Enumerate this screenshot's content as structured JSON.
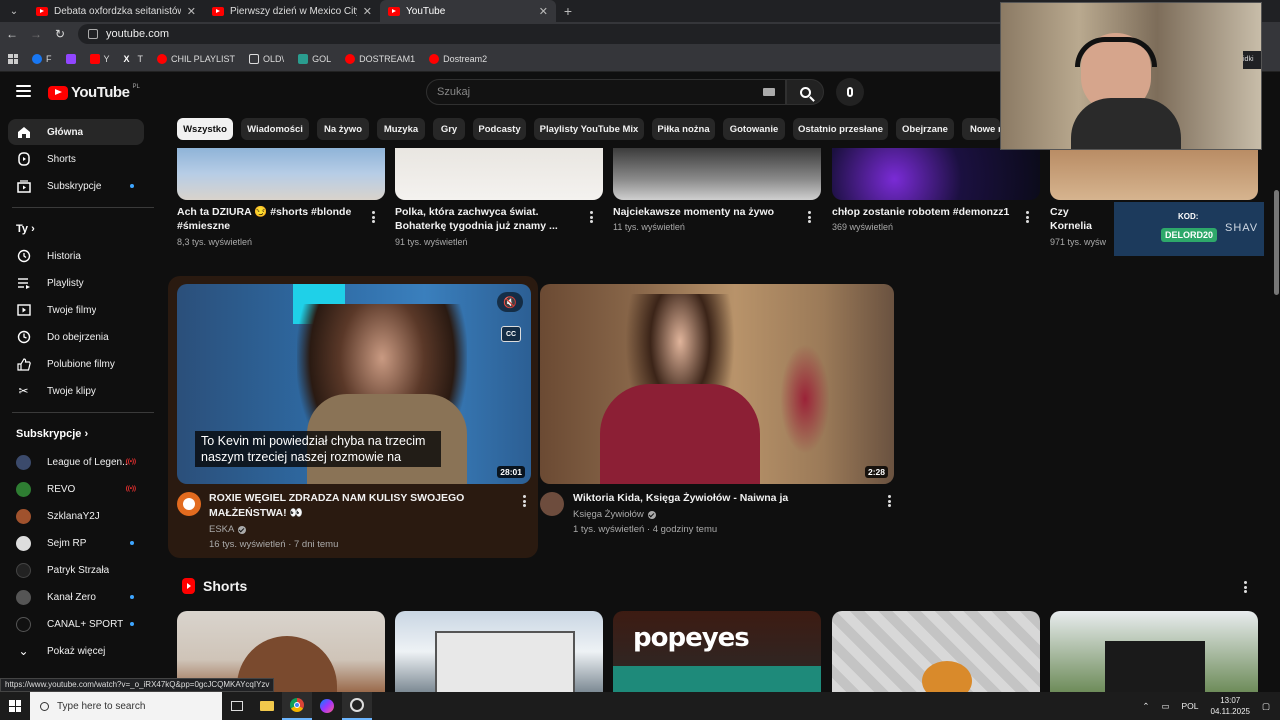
{
  "browser": {
    "tabs": [
      {
        "label": "Debata oxfordzka seitanistów n"
      },
      {
        "label": "Pierwszy dzień w Mexico City -"
      },
      {
        "label": "YouTube"
      }
    ],
    "url": "youtube.com",
    "bookmarks": [
      {
        "label": "F",
        "color": "#1877f2"
      },
      {
        "label": "",
        "color": "#9146ff"
      },
      {
        "label": "Y",
        "color": "#ff0000"
      },
      {
        "label": "T",
        "color": "#ffffff"
      },
      {
        "label": "CHIL PLAYLIST",
        "color": "#ff0000"
      },
      {
        "label": "OLD\\",
        "color": "#dddddd"
      },
      {
        "label": "GOL",
        "color": "#2a9d8f"
      },
      {
        "label": "DOSTREAM1",
        "color": "#ff0000"
      },
      {
        "label": "Dostream2",
        "color": "#ff0000"
      }
    ],
    "status_url": "https://www.youtube.com/watch?v=_o_iRX47kQ&pp=0gcJCQMKAYcqIYzv"
  },
  "header": {
    "logo_text": "YouTube",
    "region": "PL",
    "search_placeholder": "Szukaj"
  },
  "sidebar": {
    "main": [
      {
        "label": "Główna",
        "icon": "home-icon"
      },
      {
        "label": "Shorts",
        "icon": "shorts-icon"
      },
      {
        "label": "Subskrypcje",
        "icon": "subscriptions-icon"
      }
    ],
    "you_heading": "Ty",
    "you_items": [
      {
        "label": "Historia",
        "icon": "history-icon"
      },
      {
        "label": "Playlisty",
        "icon": "playlists-icon"
      },
      {
        "label": "Twoje filmy",
        "icon": "your-videos-icon"
      },
      {
        "label": "Do obejrzenia",
        "icon": "watch-later-icon"
      },
      {
        "label": "Polubione filmy",
        "icon": "liked-icon"
      },
      {
        "label": "Twoje klipy",
        "icon": "clips-icon"
      }
    ],
    "subs_heading": "Subskrypcje",
    "subscriptions": [
      {
        "label": "League of Legen...",
        "live": true,
        "color": "#3b4a6b"
      },
      {
        "label": "REVO",
        "live": true,
        "color": "#2e7d32"
      },
      {
        "label": "SzklanaY2J",
        "live": false,
        "color": "#a0522d"
      },
      {
        "label": "Sejm RP",
        "live": false,
        "color": "#dddddd"
      },
      {
        "label": "Patryk Strzała",
        "live": false,
        "color": "#222222"
      },
      {
        "label": "Kanał Zero",
        "live": false,
        "color": "#555555"
      },
      {
        "label": "CANAL+ SPORT",
        "live": false,
        "color": "#111111"
      }
    ],
    "show_more": "Pokaż więcej"
  },
  "chips": [
    "Wszystko",
    "Wiadomości",
    "Na żywo",
    "Muzyka",
    "Gry",
    "Podcasty",
    "Playlisty YouTube Mix",
    "Piłka nożna",
    "Gotowanie",
    "Ostatnio przesłane",
    "Obejrzane",
    "Nowe n"
  ],
  "top_row": [
    {
      "title": "Ach ta DZIURA 😏 #shorts #blonde #śmieszne",
      "meta": "8,3 tys. wyświetleń"
    },
    {
      "title": "Polka, która zachwyca świat. Bohaterkę tygodnia już znamy ...",
      "meta": "91 tys. wyświetleń"
    },
    {
      "title": "Najciekawsze momenty na żywo",
      "meta": "11 tys. wyświetleń"
    },
    {
      "title": "chłop zostanie robotem #demonzz1",
      "meta": "369 wyświetleń"
    },
    {
      "title": "Czy Kornelia zaręczynowy",
      "meta": "971 tys. wyśw"
    }
  ],
  "videos": [
    {
      "title": "ROXIE WĘGIEL ZDRADZA NAM KULISY SWOJEGO MAŁŻEŃSTWA! 👀",
      "channel": "ESKA",
      "meta": "16 tys. wyświetleń · 7 dni temu",
      "duration": "28:01",
      "caption": "To Kevin mi powiedział chyba na trzecim naszym trzeciej naszej rozmowie na",
      "cc_label": "CC"
    },
    {
      "title": "Wiktoria Kida, Księga Żywiołów - Naiwna ja",
      "channel": "Księga Żywiołów",
      "meta": "1 tys. wyświetleń · 4 godziny temu",
      "duration": "2:28"
    }
  ],
  "shorts_heading": "Shorts",
  "shorts_brand": "popeyes",
  "overlay": {
    "code_label": "KOD:",
    "code_value": "DELORD20",
    "brand": "SHAV",
    "side_text": "idki"
  },
  "taskbar": {
    "search_placeholder": "Type here to search",
    "lang": "POL",
    "time": "13:07",
    "date": "04.11.2025"
  }
}
